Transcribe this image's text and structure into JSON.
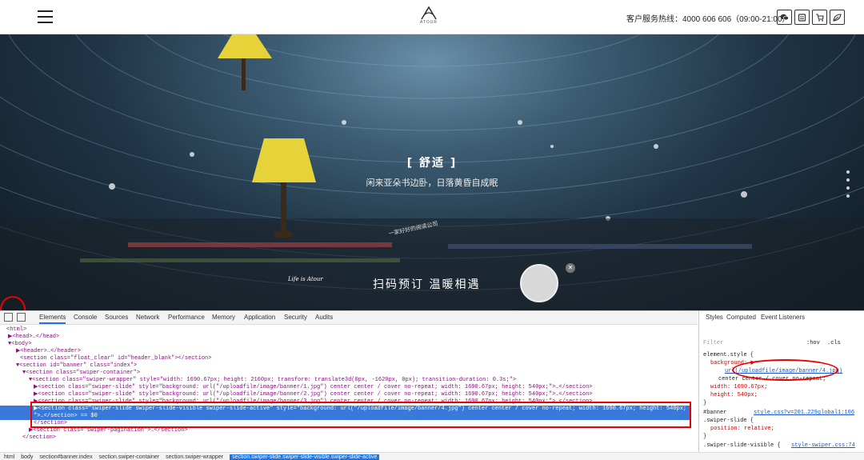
{
  "header": {
    "logo_text": "ATOUR",
    "hotline_label": "客户服务热线：",
    "hotline_number": "4000 606 606",
    "hotline_hours": "（09:00-21:00）",
    "icons": [
      "wechat-icon",
      "weibo-icon",
      "cart-icon",
      "leaf-icon"
    ]
  },
  "banner": {
    "title": "[ 舒适 ]",
    "subtitle": "闲来亚朵书边卧，日落黄昏自成眠",
    "ribbon_text": "一家好好的阅读公司",
    "life_logo": "Life is Atour",
    "scan_text": "扫码预订  温暖相遇"
  },
  "devtools": {
    "tabs": [
      "Elements",
      "Console",
      "Sources",
      "Network",
      "Performance",
      "Memory",
      "Application",
      "Security",
      "Audits"
    ],
    "dom_lines": [
      "<html>",
      "▶<head>…</head>",
      "▼<body>",
      "▶<header>…</header>",
      "<section class=\"float_clear\" id=\"header_blank\"></section>",
      "▼<section id=\"banner\" class=\"index\">",
      "▼<section class=\"swiper-container\">",
      "▼<section class=\"swiper-wrapper\" style=\"width: 1690.67px; height: 2160px; transform: translate3d(0px, -1620px, 0px); transition-duration: 0.3s;\">",
      "▶<section class=\"swiper-slide\" style=\"background: url(\"/uploadfile/image/banner/1.jpg\") center center / cover no-repeat; width: 1690.67px; height: 540px;\">…</section>",
      "▶<section class=\"swiper-slide\" style=\"background: url(\"/uploadfile/image/banner/2.jpg\") center center / cover no-repeat; width: 1690.67px; height: 540px;\">…</section>",
      "▶<section class=\"swiper-slide\" style=\"background: url(\"/uploadfile/image/banner/3.jpg\") center center / cover no-repeat; width: 1690.67px; height: 540px;\">…</section>",
      "▶<section class=\"swiper-slide swiper-slide-visible swiper-slide-active\" style=\"background: url(\"/uploadfile/image/banner/4.jpg\") center center / cover no-repeat; width: 1690.67px; height: 540px;",
      "\">…</section> == $0",
      "</section>",
      "▶<section class=\"swiper-pagination\">…</section>",
      "</section>"
    ],
    "styles_tabs": [
      "Styles",
      "Computed",
      "Event Listeners"
    ],
    "filter_placeholder": "Filter",
    "filter_hov": ":hov",
    "filter_cls": ".cls",
    "style_lines": [
      "element.style {",
      "background: ▶",
      "url(/uploadfile/image/banner/4.jpg)",
      "center center / cover no-repeat;",
      "width: 1690.67px;",
      "height: 540px;",
      "}",
      "#banner",
      "style.css?v=201…229global1:106",
      ".swiper-slide {",
      "position: relative;",
      "}",
      ".swiper-slide-visible {",
      "style-swiper.css:74"
    ],
    "breadcrumbs": [
      "html",
      "body",
      "section#banner.index",
      "section.swiper-container",
      "section.swiper-wrapper",
      "section.swiper-slide.swiper-slide-visible.swiper-slide-active"
    ]
  }
}
